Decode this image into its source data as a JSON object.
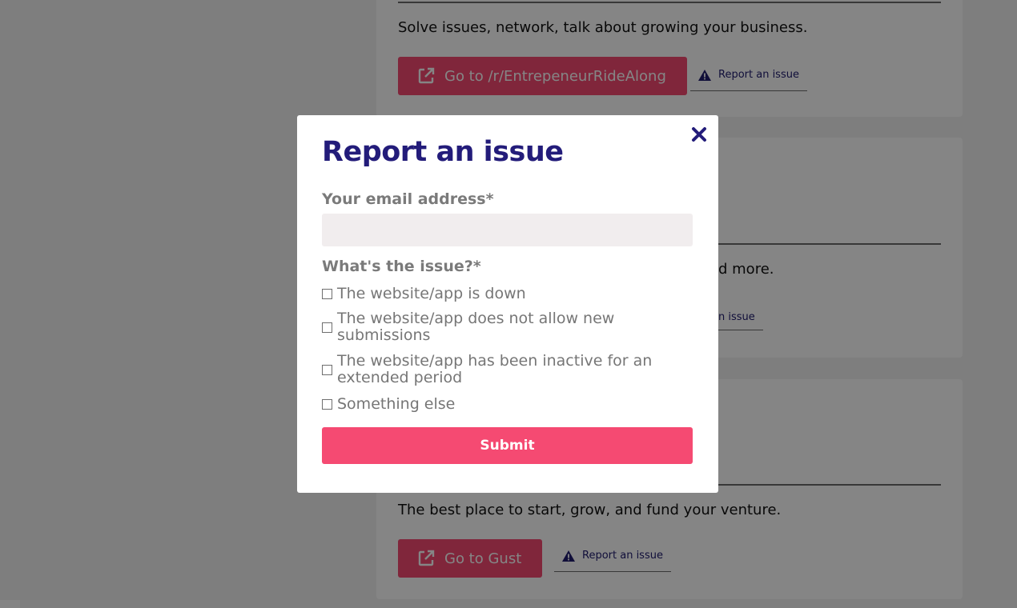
{
  "background": {
    "cards": [
      {
        "description": "Solve issues, network, talk about growing your business.",
        "go_label": "Go to /r/EntrepeneurRideAlong",
        "report_label": "Report an issue"
      },
      {
        "partial_description": "d more.",
        "partial_report_label": "n issue"
      },
      {
        "description": "The best place to start, grow, and fund your venture.",
        "go_label": "Go to Gust",
        "report_label": "Report an issue"
      }
    ]
  },
  "modal": {
    "title": "Report an issue",
    "email_label": "Your email address*",
    "email_value": "",
    "issue_label": "What's the issue?*",
    "options": [
      {
        "line1": "The website/app is down",
        "line2": "",
        "checked": false
      },
      {
        "line1": "The website/app does not allow new",
        "line2": "submissions",
        "checked": false
      },
      {
        "line1": "The website/app has been inactive for an",
        "line2": "extended period",
        "checked": false
      },
      {
        "line1": "Something else",
        "line2": "",
        "checked": false
      }
    ],
    "submit_label": "Submit"
  },
  "colors": {
    "accent": "#f54a72",
    "title": "#231c7a",
    "overlay": "rgba(0,0,0,0.48)"
  }
}
